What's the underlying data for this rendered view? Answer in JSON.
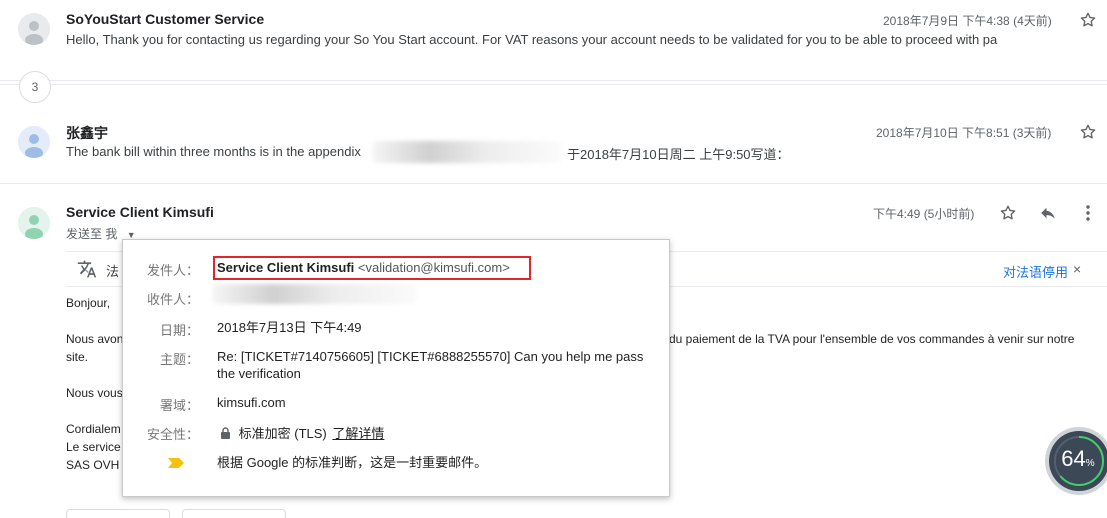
{
  "thread": {
    "messages": [
      {
        "sender": "SoYouStart Customer Service",
        "snippet": "Hello, Thank you for contacting us regarding your So You Start account. For VAT reasons your account needs to be validated for you to be able to proceed with pa",
        "date": "2018年7月9日 下午4:38 (4天前)"
      },
      {
        "sender": "张鑫宇",
        "snippet_start": "The bank bill within three months is in the appendix",
        "snippet_end": "于2018年7月10日周二 上午9:50写道：",
        "date": "2018年7月10日 下午8:51 (3天前)"
      },
      {
        "sender": "Service Client Kimsufi",
        "sent_to": "发送至 我",
        "date": "下午4:49 (5小时前)"
      }
    ],
    "collapsed_count": "3"
  },
  "translate": {
    "from_lang": "法",
    "stop_translate": "对法语停用"
  },
  "email_body": {
    "line1": "Bonjour,",
    "line2a": "Nous avon",
    "line2b": "du paiement de la TVA pour l'ensemble de vos commandes à venir sur notre",
    "line2c": "site.",
    "line3": "Nous vous",
    "line4": "Cordialem",
    "line5": "Le service",
    "line6": "SAS OVH"
  },
  "details_popup": {
    "from_label": "发件人：",
    "from_name": "Service Client Kimsufi",
    "from_email": "<validation@kimsufi.com>",
    "to_label": "收件人：",
    "date_label": "日期：",
    "date_value": "2018年7月13日 下午4:49",
    "subject_label": "主题：",
    "subject_value": "Re: [TICKET#7140756605] [TICKET#6888255570] Can you help me pass the verification",
    "signed_label": "署域：",
    "signed_value": "kimsufi.com",
    "security_label": "安全性：",
    "security_value": "标准加密 (TLS)",
    "security_link": "了解详情",
    "importance_text": "根据 Google 的标准判断，这是一封重要邮件。"
  },
  "progress_widget": {
    "value": "64",
    "unit": "%",
    "fraction": 0.64
  },
  "colors": {
    "highlight_red": "#e0262b",
    "importance_yellow": "#f4c20d",
    "link_blue": "#1a73e8",
    "progress_green": "#3fcf6b"
  }
}
